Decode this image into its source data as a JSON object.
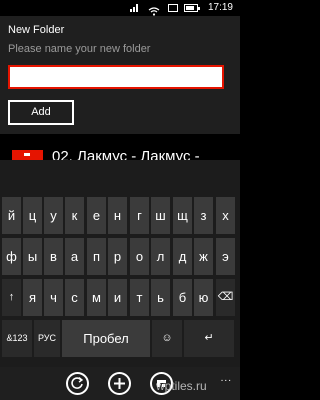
{
  "status": {
    "time": "17:19"
  },
  "dialog": {
    "title": "New Folder",
    "prompt": "Please name your new folder",
    "input_value": "",
    "add_label": "Add"
  },
  "list": {
    "item_title": "02. Лакмус - Лакмус -"
  },
  "keyboard": {
    "row1": [
      "й",
      "ц",
      "у",
      "к",
      "е",
      "н",
      "г",
      "ш",
      "щ",
      "з",
      "х"
    ],
    "row2": [
      "ф",
      "ы",
      "в",
      "а",
      "п",
      "р",
      "о",
      "л",
      "д",
      "ж",
      "э"
    ],
    "row3": [
      "я",
      "ч",
      "с",
      "м",
      "и",
      "т",
      "ь",
      "б",
      "ю"
    ],
    "shift_symbol": "↑",
    "backspace_symbol": "⌫",
    "symbols_label": "&123",
    "lang_label": "РУС",
    "space_label": "Пробел",
    "emoji_symbol": "☺",
    "enter_symbol": "↵"
  },
  "appbar": {
    "more": "..."
  },
  "watermark": "wptiles.ru",
  "colors": {
    "accent": "#e51400",
    "key": "#3b3b3b",
    "dialog": "#1f1f1f"
  }
}
